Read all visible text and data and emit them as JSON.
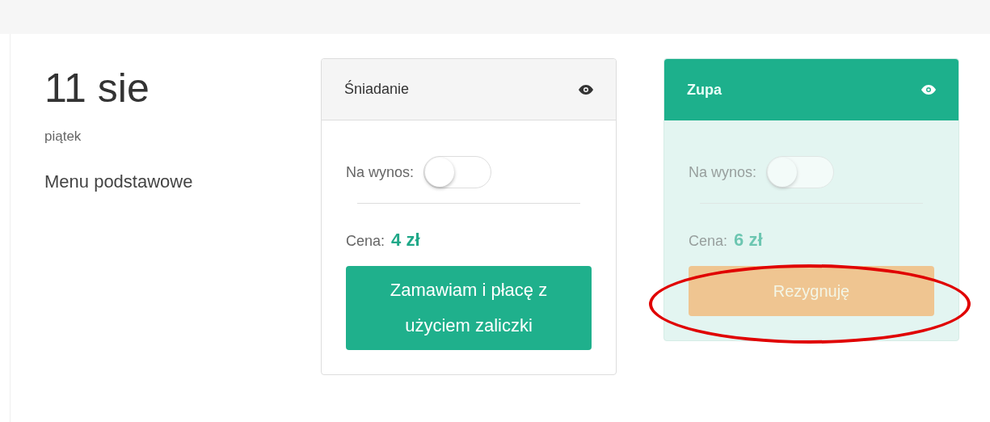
{
  "day": {
    "date": "11 sie",
    "weekday": "piątek",
    "menu": "Menu podstawowe"
  },
  "meals": [
    {
      "title": "Śniadanie",
      "selected": false,
      "takeaway_label": "Na wynos:",
      "takeaway_on": false,
      "price_label": "Cena:",
      "price": "4 zł",
      "button": {
        "kind": "order",
        "label": "Zamawiam i płacę z użyciem zaliczki"
      },
      "highlighted": false
    },
    {
      "title": "Zupa",
      "selected": true,
      "takeaway_label": "Na wynos:",
      "takeaway_on": false,
      "price_label": "Cena:",
      "price": "6 zł",
      "button": {
        "kind": "cancel",
        "label": "Rezygnuję"
      },
      "highlighted": true
    }
  ]
}
